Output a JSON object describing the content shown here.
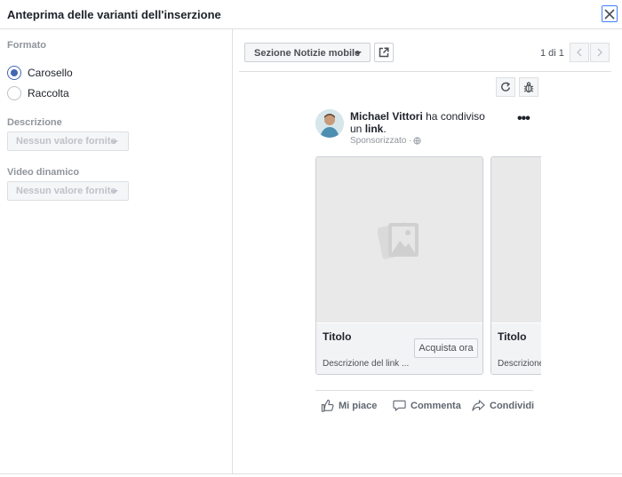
{
  "dialog": {
    "title": "Anteprima delle varianti dell'inserzione",
    "close_icon": "close-icon"
  },
  "left": {
    "format_label": "Formato",
    "format_options": [
      {
        "label": "Carosello",
        "selected": true
      },
      {
        "label": "Raccolta",
        "selected": false
      }
    ],
    "description_label": "Descrizione",
    "description_value": "Nessun valore fornito",
    "dynamic_video_label": "Video dinamico",
    "dynamic_video_value": "Nessun valore fornito"
  },
  "preview": {
    "placement": "Sezione Notizie mobile",
    "pager": "1 di 1",
    "author": "Michael Vittori",
    "shared_text": " ha condiviso un ",
    "link_text": "link",
    "period": ".",
    "sponsored": "Sponsorizzato · ",
    "more": "•••",
    "cards": [
      {
        "title": "Titolo",
        "description": "Descrizione del link ...",
        "cta": "Acquista ora"
      },
      {
        "title": "Titolo",
        "description": "Descrizione del link ..."
      }
    ],
    "actions": {
      "like": "Mi piace",
      "comment": "Commenta",
      "share": "Condividi"
    }
  },
  "colors": {
    "accent": "#4267b2",
    "border": "#dddfe2",
    "muted": "#90949c"
  }
}
